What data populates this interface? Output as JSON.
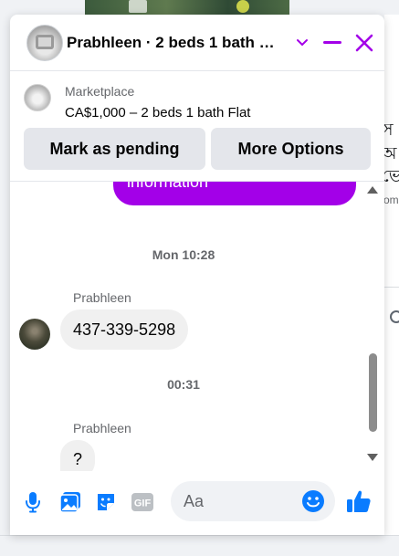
{
  "header": {
    "title": "Prabhleen · 2 beds 1 bath …"
  },
  "listing": {
    "label": "Marketplace",
    "price_title": "CA$1,000 – 2 beds 1 bath Flat"
  },
  "actions": {
    "pending_label": "Mark as pending",
    "more_label": "More Options"
  },
  "messages": {
    "sent_partial_text": "information",
    "timestamp_1": "Mon 10:28",
    "sender_1": "Prabhleen",
    "message_1": "437-339-5298",
    "timestamp_2": "00:31",
    "sender_2": "Prabhleen",
    "message_2": "?"
  },
  "composer": {
    "placeholder": "Aa"
  },
  "background": {
    "right_char_1": "স",
    "right_char_2": "অ",
    "right_char_3": "ভে",
    "right_small": "om"
  },
  "colors": {
    "accent": "#a300e8",
    "composer_icons": "#0a7cff"
  },
  "icons": {
    "chevron": "chevron-down-icon",
    "minimize": "minimize-icon",
    "close": "close-icon",
    "mic": "microphone-icon",
    "photo": "photo-icon",
    "sticker": "sticker-icon",
    "gif": "gif-icon",
    "emoji": "emoji-icon",
    "like": "thumbs-up-icon"
  }
}
